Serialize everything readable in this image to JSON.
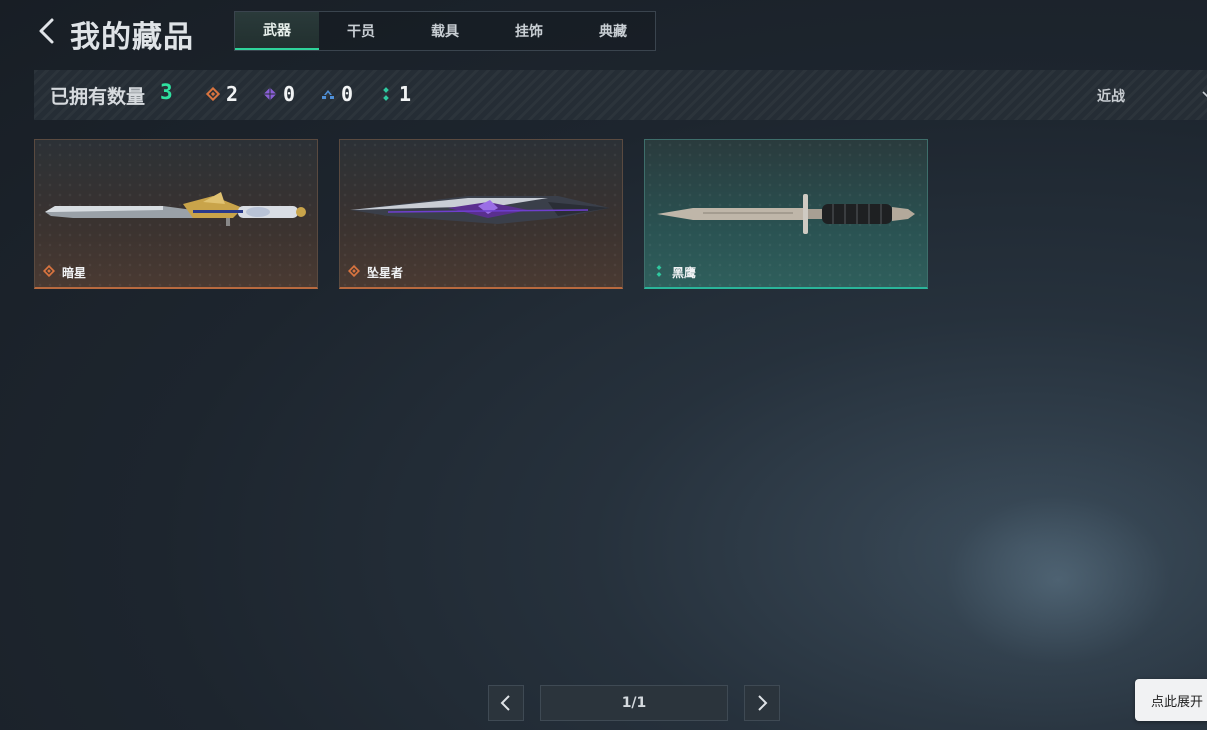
{
  "header": {
    "title": "我的藏品",
    "tabs": [
      {
        "label": "武器",
        "active": true
      },
      {
        "label": "干员",
        "active": false
      },
      {
        "label": "载具",
        "active": false
      },
      {
        "label": "挂饰",
        "active": false
      },
      {
        "label": "典藏",
        "active": false
      }
    ]
  },
  "stats": {
    "owned_label": "已拥有数量",
    "owned_count": "3",
    "rarities": [
      {
        "icon": "orange-diamond-icon",
        "color": "#d9743f",
        "count": "2"
      },
      {
        "icon": "purple-diamond-icon",
        "color": "#8a5fd6",
        "count": "0"
      },
      {
        "icon": "blue-chevron-icon",
        "color": "#4f8fd6",
        "count": "0"
      },
      {
        "icon": "teal-dots-icon",
        "color": "#2fc9a0",
        "count": "1"
      }
    ],
    "filter_label": "近战"
  },
  "items": [
    {
      "name": "暗星",
      "rarity_color": "#d9743f",
      "style": "orange",
      "weapon_icon": "ornate-knife-icon"
    },
    {
      "name": "坠星者",
      "rarity_color": "#d9743f",
      "style": "orange",
      "weapon_icon": "purple-blade-icon"
    },
    {
      "name": "黑鹰",
      "rarity_color": "#2fc9a0",
      "style": "teal",
      "weapon_icon": "combat-knife-icon"
    }
  ],
  "pagination": {
    "label": "1/1"
  },
  "expand_button": {
    "label": "点此展开"
  },
  "colors": {
    "accent": "#2fe1a0"
  }
}
